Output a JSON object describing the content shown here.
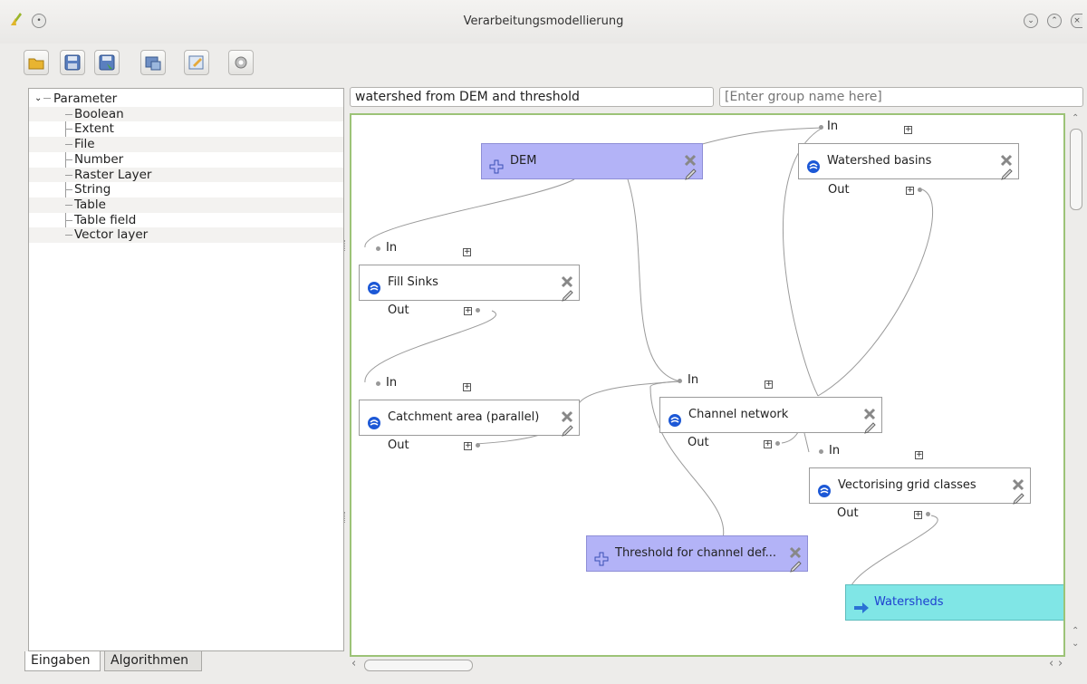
{
  "window": {
    "title": "Verarbeitungsmodellierung"
  },
  "toolbar": {
    "icons": [
      "open-folder-icon",
      "save-icon",
      "save-as-icon",
      "export-image-icon",
      "edit-help-icon",
      "run-icon"
    ]
  },
  "parameters": {
    "root": "Parameter",
    "items": [
      "Boolean",
      "Extent",
      "File",
      "Number",
      "Raster Layer",
      "String",
      "Table",
      "Table field",
      "Vector layer"
    ]
  },
  "tabs": {
    "inputs": "Eingaben",
    "algorithms": "Algorithmen"
  },
  "model": {
    "name_value": "watershed from DEM and threshold",
    "group_placeholder": "[Enter group name here]"
  },
  "ports": {
    "in": "In",
    "out": "Out"
  },
  "nodes": {
    "dem": "DEM",
    "watershed_basins": "Watershed basins",
    "fill_sinks": "Fill Sinks",
    "catchment_area": "Catchment area (parallel)",
    "channel_network": "Channel network",
    "vectorising": "Vectorising grid classes",
    "threshold": "Threshold for channel def...",
    "watersheds": "Watersheds"
  },
  "colors": {
    "param_node": "#b3b3f7",
    "output_node": "#80e6e6",
    "canvas_border": "#9cc377"
  }
}
